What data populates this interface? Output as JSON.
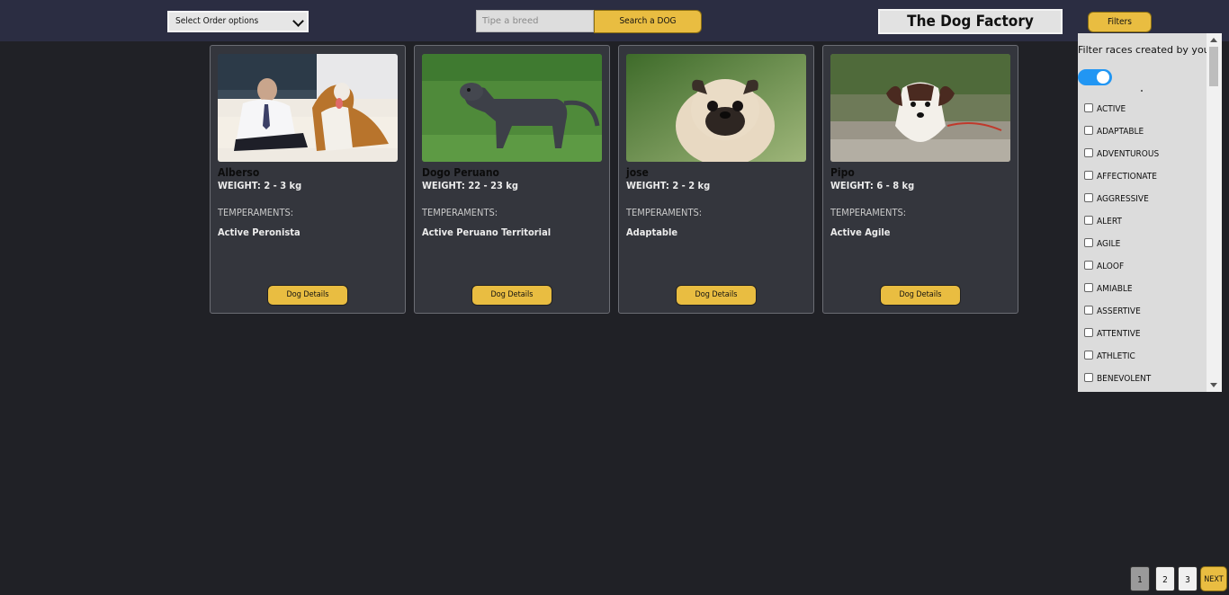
{
  "header": {
    "order_select": "Select Order options",
    "search_placeholder": "Tipe a breed",
    "search_button": "Search a DOG",
    "brand": "The Dog Factory",
    "filters_button": "Filters"
  },
  "cards": [
    {
      "name": "Alberso",
      "weight": "WEIGHT: 2 - 3 kg",
      "temp_label": "TEMPERAMENTS:",
      "temperaments": "Active Peronista",
      "button": "Dog Details"
    },
    {
      "name": "Dogo Peruano",
      "weight": "WEIGHT: 22 - 23 kg",
      "temp_label": "TEMPERAMENTS:",
      "temperaments": "Active Peruano Territorial",
      "button": "Dog Details"
    },
    {
      "name": "jose",
      "weight": "WEIGHT: 2 - 2 kg",
      "temp_label": "TEMPERAMENTS:",
      "temperaments": "Adaptable",
      "button": "Dog Details"
    },
    {
      "name": "Pipo",
      "weight": "WEIGHT: 6 - 8 kg",
      "temp_label": "TEMPERAMENTS:",
      "temperaments": "Active Agile",
      "button": "Dog Details"
    }
  ],
  "filter_panel": {
    "title": "Filter races created by you:",
    "toggle_on": true,
    "options": [
      "ACTIVE",
      "ADAPTABLE",
      "ADVENTUROUS",
      "AFFECTIONATE",
      "AGGRESSIVE",
      "ALERT",
      "AGILE",
      "ALOOF",
      "AMIABLE",
      "ASSERTIVE",
      "ATTENTIVE",
      "ATHLETIC",
      "BENEVOLENT"
    ]
  },
  "pagination": {
    "pages": [
      "1",
      "2",
      "3"
    ],
    "current": "1",
    "next": "NEXT"
  },
  "colors": {
    "background": "#202126",
    "header": "#2b2d42",
    "accent": "#e9bd41",
    "card": "#34363d",
    "toggle": "#2196f3"
  }
}
